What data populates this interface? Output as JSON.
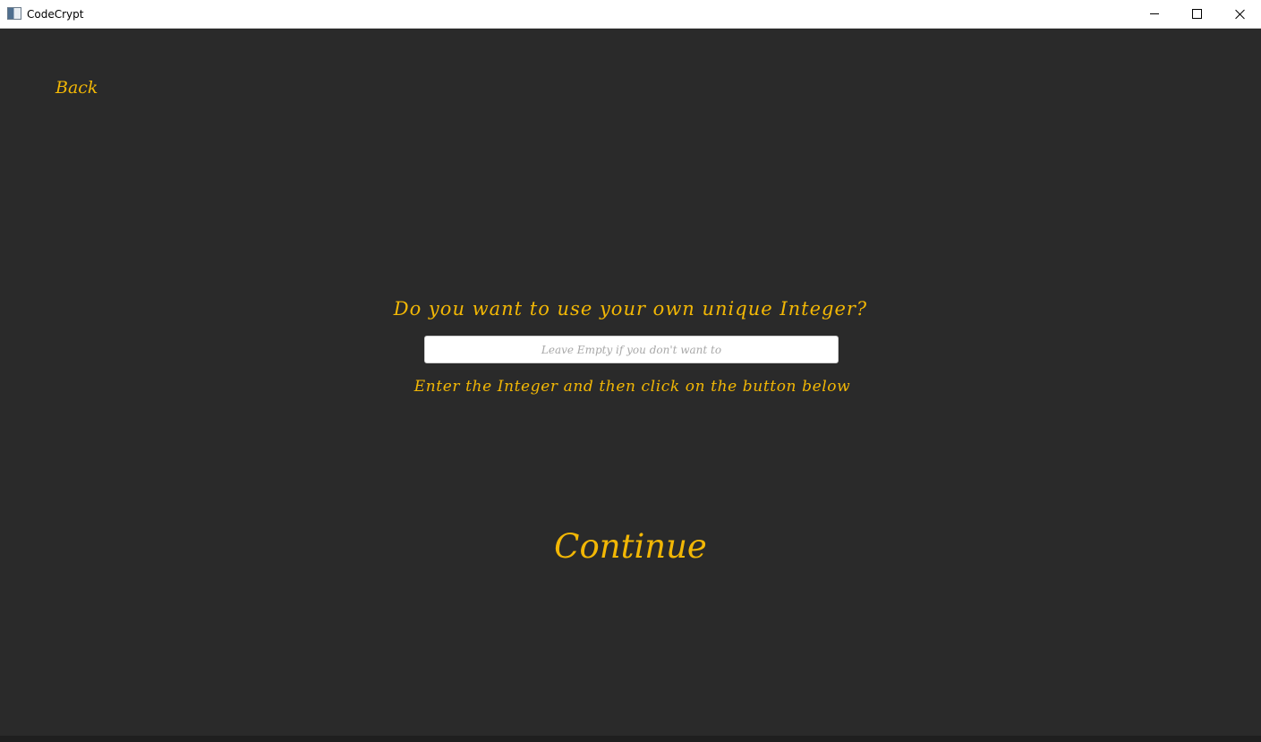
{
  "window": {
    "title": "CodeCrypt",
    "minimize_icon": "minimize-icon",
    "maximize_icon": "maximize-icon",
    "close_icon": "close-icon",
    "app_icon": "app-icon"
  },
  "colors": {
    "background": "#2a2a2a",
    "accent": "#f2b705",
    "input_background": "#ffffff"
  },
  "nav": {
    "back_label": "Back"
  },
  "form": {
    "question": "Do you want to use your own unique Integer?",
    "integer_placeholder": "Leave Empty if you don't want to",
    "integer_value": "",
    "hint": "Enter the Integer and then click on the button below",
    "continue_label": "Continue"
  }
}
